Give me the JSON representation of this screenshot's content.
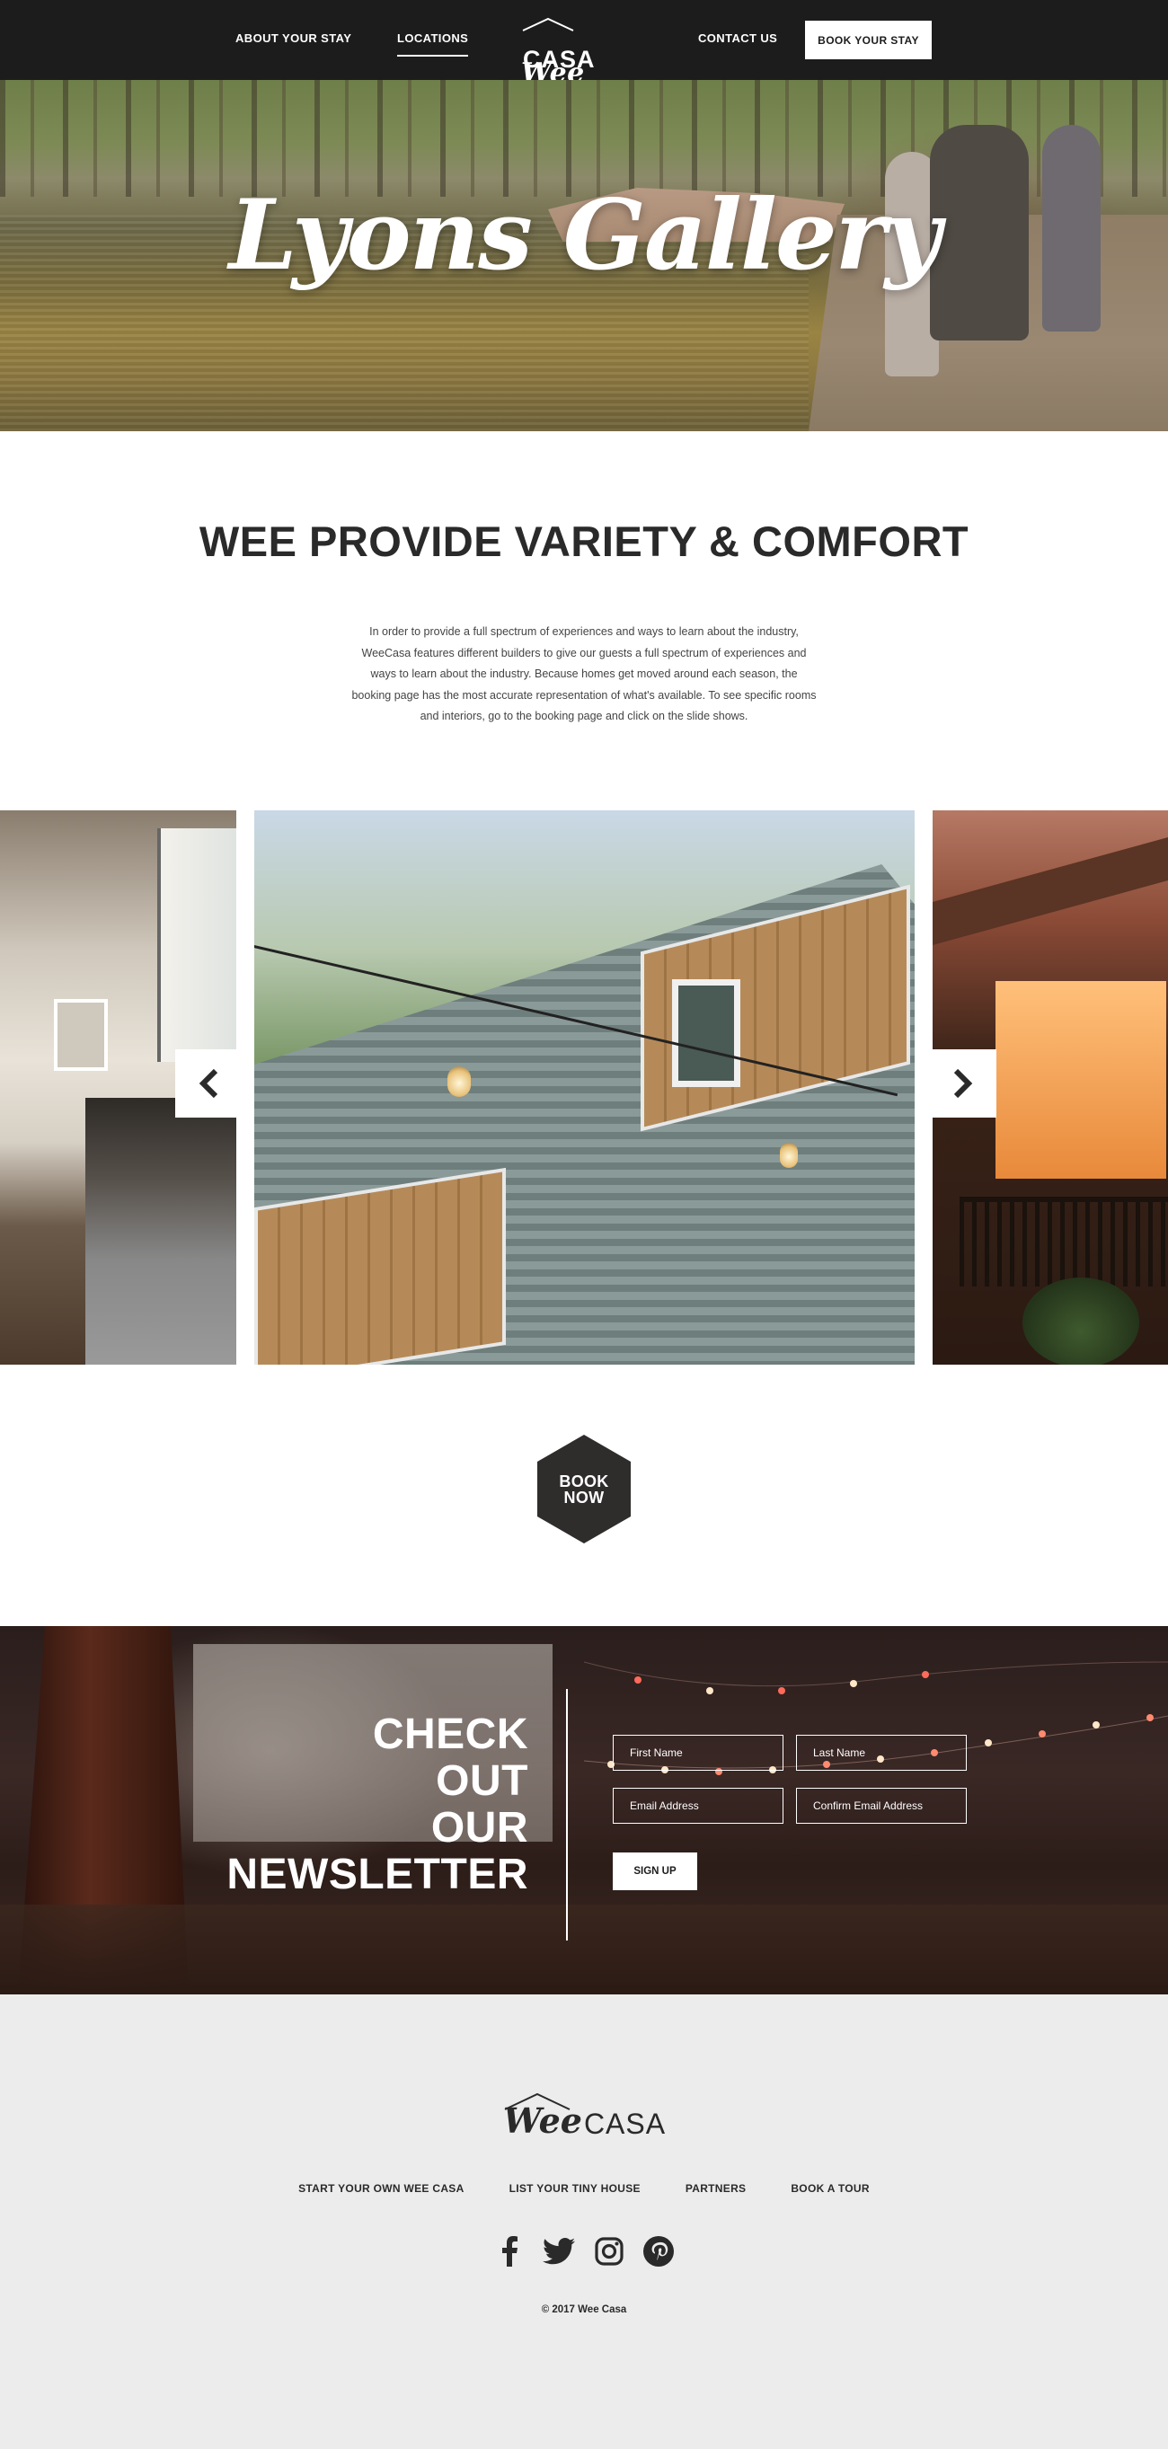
{
  "nav": {
    "about": "ABOUT YOUR STAY",
    "locations": "LOCATIONS",
    "contact": "CONTACT US",
    "book": "BOOK YOUR STAY",
    "logo_wee": "Wee",
    "logo_casa": "CASA"
  },
  "hero": {
    "title": "Lyons Gallery"
  },
  "intro": {
    "heading": "WEE PROVIDE VARIETY & COMFORT",
    "body": "In order to provide a full spectrum of experiences and ways to learn about the industry, WeeCasa features different builders to give our guests a full spectrum of experiences and ways to learn about the industry. Because homes get moved around each season, the booking page has the most accurate representation of what's available. To see specific rooms and interiors, go to the booking page and click on the slide shows."
  },
  "carousel": {
    "prev_icon": "chevron-left-icon",
    "next_icon": "chevron-right-icon"
  },
  "book_now": {
    "line1": "BOOK",
    "line2": "NOW"
  },
  "newsletter": {
    "heading_lines": [
      "CHECK",
      "OUT",
      "OUR",
      "NEWSLETTER"
    ],
    "first_name": "First Name",
    "last_name": "Last Name",
    "email": "Email Address",
    "confirm_email": "Confirm Email Address",
    "signup": "SIGN UP"
  },
  "footer": {
    "logo_wee": "Wee",
    "logo_casa": "CASA",
    "links": [
      "START YOUR OWN WEE CASA",
      "LIST YOUR TINY HOUSE",
      "PARTNERS",
      "BOOK A TOUR"
    ],
    "social": [
      "facebook-icon",
      "twitter-icon",
      "instagram-icon",
      "pinterest-icon"
    ],
    "copyright": "© 2017 Wee Casa"
  },
  "colors": {
    "nav_bg": "#1c1c1c",
    "text_dark": "#2a2a2a",
    "footer_bg": "#ececec",
    "book_hex": "#2f2c2c"
  }
}
